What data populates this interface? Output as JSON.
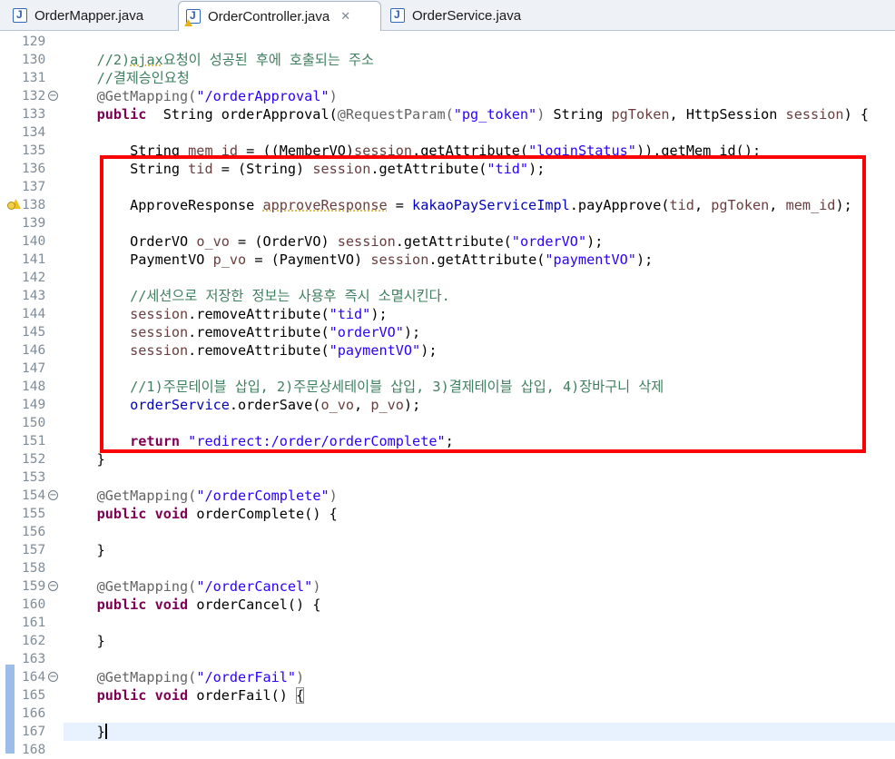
{
  "tabs": [
    {
      "label": "OrderMapper.java",
      "icon": "java-file-icon",
      "active": false
    },
    {
      "label": "OrderController.java",
      "icon": "java-file-warning-icon",
      "active": true,
      "close": "✕"
    },
    {
      "label": "OrderService.java",
      "icon": "java-file-icon",
      "active": false
    }
  ],
  "lines": [
    {
      "n": "129",
      "tokens": []
    },
    {
      "n": "130",
      "tokens": [
        [
          "cm",
          "    //2)"
        ],
        [
          "cm uline",
          "ajax"
        ],
        [
          "cm",
          "요청이 성공된 후에 호출되는 주소"
        ]
      ]
    },
    {
      "n": "131",
      "tokens": [
        [
          "cm",
          "    //결제승인요청"
        ]
      ]
    },
    {
      "n": "132",
      "fold": true,
      "tokens": [
        [
          "ann",
          "    @GetMapping("
        ],
        [
          "str",
          "\"/orderApproval\""
        ],
        [
          "ann",
          ")"
        ]
      ]
    },
    {
      "n": "133",
      "tokens": [
        [
          "kw",
          "    public"
        ],
        [
          "",
          "  String orderApproval("
        ],
        [
          "ann",
          "@RequestParam("
        ],
        [
          "str",
          "\"pg_token\""
        ],
        [
          "ann",
          ")"
        ],
        [
          "",
          " String "
        ],
        [
          "lv",
          "pgToken"
        ],
        [
          "",
          ", HttpSession "
        ],
        [
          "lv",
          "session"
        ],
        [
          "",
          ") {"
        ]
      ]
    },
    {
      "n": "134",
      "tokens": []
    },
    {
      "n": "135",
      "tokens": [
        [
          "",
          "        String "
        ],
        [
          "lv",
          "mem_id"
        ],
        [
          "",
          " = ((MemberVO)"
        ],
        [
          "lv",
          "session"
        ],
        [
          "",
          ".getAttribute("
        ],
        [
          "str",
          "\"loginStatus\""
        ],
        [
          "",
          "))"
        ],
        [
          "",
          ".getMem_id();"
        ]
      ]
    },
    {
      "n": "136",
      "tokens": [
        [
          "",
          "        String "
        ],
        [
          "lv",
          "tid"
        ],
        [
          "",
          " = (String) "
        ],
        [
          "lv",
          "session"
        ],
        [
          "",
          ".getAttribute("
        ],
        [
          "str",
          "\"tid\""
        ],
        [
          "",
          ");"
        ]
      ]
    },
    {
      "n": "137",
      "tokens": []
    },
    {
      "n": "138",
      "warn": true,
      "tokens": [
        [
          "",
          "        ApproveResponse "
        ],
        [
          "lv uline",
          "approveResponse"
        ],
        [
          "",
          " = "
        ],
        [
          "fld",
          "kakaoPayServiceImpl"
        ],
        [
          "",
          ".payApprove("
        ],
        [
          "lv",
          "tid"
        ],
        [
          "",
          ", "
        ],
        [
          "lv",
          "pgToken"
        ],
        [
          "",
          ", "
        ],
        [
          "lv",
          "mem_id"
        ],
        [
          "",
          ");"
        ]
      ]
    },
    {
      "n": "139",
      "tokens": []
    },
    {
      "n": "140",
      "tokens": [
        [
          "",
          "        OrderVO "
        ],
        [
          "lv",
          "o_vo"
        ],
        [
          "",
          " = (OrderVO) "
        ],
        [
          "lv",
          "session"
        ],
        [
          "",
          ".getAttribute("
        ],
        [
          "str",
          "\"orderVO\""
        ],
        [
          "",
          ");"
        ]
      ]
    },
    {
      "n": "141",
      "tokens": [
        [
          "",
          "        PaymentVO "
        ],
        [
          "lv",
          "p_vo"
        ],
        [
          "",
          " = (PaymentVO) "
        ],
        [
          "lv",
          "session"
        ],
        [
          "",
          ".getAttribute("
        ],
        [
          "str",
          "\"paymentVO\""
        ],
        [
          "",
          ");"
        ]
      ]
    },
    {
      "n": "142",
      "tokens": []
    },
    {
      "n": "143",
      "tokens": [
        [
          "cm",
          "        //세션으로 저장한 정보는 사용후 즉시 소멸시킨다."
        ]
      ]
    },
    {
      "n": "144",
      "tokens": [
        [
          "lv",
          "        session"
        ],
        [
          "",
          ".removeAttribute("
        ],
        [
          "str",
          "\"tid\""
        ],
        [
          "",
          ");"
        ]
      ]
    },
    {
      "n": "145",
      "tokens": [
        [
          "lv",
          "        session"
        ],
        [
          "",
          ".removeAttribute("
        ],
        [
          "str",
          "\"orderVO\""
        ],
        [
          "",
          ");"
        ]
      ]
    },
    {
      "n": "146",
      "tokens": [
        [
          "lv",
          "        session"
        ],
        [
          "",
          ".removeAttribute("
        ],
        [
          "str",
          "\"paymentVO\""
        ],
        [
          "",
          ");"
        ]
      ]
    },
    {
      "n": "147",
      "tokens": []
    },
    {
      "n": "148",
      "tokens": [
        [
          "cm",
          "        //1)주문테이블 삽입, 2)주문상세테이블 삽입, 3)결제테이블 삽입, 4)장바구니 삭제"
        ]
      ]
    },
    {
      "n": "149",
      "tokens": [
        [
          "fld",
          "        orderService"
        ],
        [
          "",
          ".orderSave("
        ],
        [
          "lv",
          "o_vo"
        ],
        [
          "",
          ", "
        ],
        [
          "lv",
          "p_vo"
        ],
        [
          "",
          ");"
        ]
      ]
    },
    {
      "n": "150",
      "tokens": []
    },
    {
      "n": "151",
      "tokens": [
        [
          "kw",
          "        return"
        ],
        [
          "",
          " "
        ],
        [
          "str",
          "\"redirect:/order/orderComplete\""
        ],
        [
          "",
          ";"
        ]
      ]
    },
    {
      "n": "152",
      "tokens": [
        [
          "",
          "    }"
        ]
      ]
    },
    {
      "n": "153",
      "tokens": []
    },
    {
      "n": "154",
      "fold": true,
      "tokens": [
        [
          "ann",
          "    @GetMapping("
        ],
        [
          "str",
          "\"/orderComplete\""
        ],
        [
          "ann",
          ")"
        ]
      ]
    },
    {
      "n": "155",
      "tokens": [
        [
          "kw",
          "    public"
        ],
        [
          "",
          " "
        ],
        [
          "kw",
          "void"
        ],
        [
          "",
          " orderComplete() {"
        ]
      ]
    },
    {
      "n": "156",
      "tokens": []
    },
    {
      "n": "157",
      "tokens": [
        [
          "",
          "    }"
        ]
      ]
    },
    {
      "n": "158",
      "tokens": []
    },
    {
      "n": "159",
      "fold": true,
      "tokens": [
        [
          "ann",
          "    @GetMapping("
        ],
        [
          "str",
          "\"/orderCancel\""
        ],
        [
          "ann",
          ")"
        ]
      ]
    },
    {
      "n": "160",
      "tokens": [
        [
          "kw",
          "    public"
        ],
        [
          "",
          " "
        ],
        [
          "kw",
          "void"
        ],
        [
          "",
          " orderCancel() {"
        ]
      ]
    },
    {
      "n": "161",
      "tokens": []
    },
    {
      "n": "162",
      "tokens": [
        [
          "",
          "    }"
        ]
      ]
    },
    {
      "n": "163",
      "tokens": []
    },
    {
      "n": "164",
      "fold": true,
      "tokens": [
        [
          "ann",
          "    @GetMapping("
        ],
        [
          "str",
          "\"/orderFail\""
        ],
        [
          "ann",
          ")"
        ]
      ]
    },
    {
      "n": "165",
      "tokens": [
        [
          "kw",
          "    public"
        ],
        [
          "",
          " "
        ],
        [
          "kw",
          "void"
        ],
        [
          "",
          " orderFail() "
        ],
        [
          "bracket",
          "{"
        ]
      ]
    },
    {
      "n": "166",
      "tokens": []
    },
    {
      "n": "167",
      "current": true,
      "caret": true,
      "tokens": [
        [
          "",
          "    }"
        ]
      ]
    },
    {
      "n": "168",
      "tokens": []
    }
  ]
}
